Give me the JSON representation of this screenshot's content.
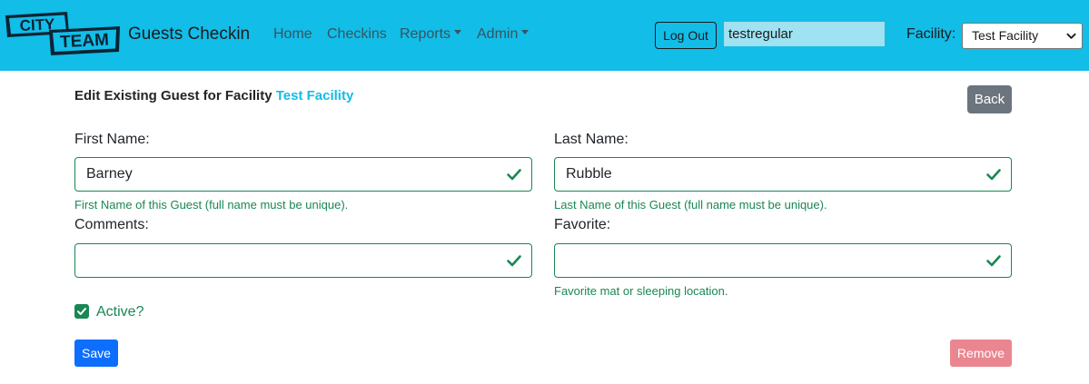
{
  "navbar": {
    "logo_text_top": "CITY",
    "logo_text_bottom": "TEAM",
    "brand": "Guests Checkin",
    "links": [
      "Home",
      "Checkins",
      "Reports",
      "Admin"
    ],
    "logout_label": "Log Out",
    "username": "testregular",
    "facility_label": "Facility:",
    "facility_selected": "Test Facility",
    "color": "#12bde8"
  },
  "page": {
    "title_prefix": "Edit Existing Guest for Facility",
    "facility_name": "Test Facility",
    "back_label": "Back"
  },
  "form": {
    "first_name": {
      "label": "First Name:",
      "value": "Barney",
      "help": "First Name of this Guest (full name must be unique)."
    },
    "last_name": {
      "label": "Last Name:",
      "value": "Rubble",
      "help": "Last Name of this Guest (full name must be unique)."
    },
    "comments": {
      "label": "Comments:",
      "value": ""
    },
    "favorite": {
      "label": "Favorite:",
      "value": "",
      "help": "Favorite mat or sleeping location."
    },
    "active": {
      "label": "Active?",
      "checked": true
    },
    "save_label": "Save",
    "remove_label": "Remove",
    "valid_color": "#198754"
  }
}
